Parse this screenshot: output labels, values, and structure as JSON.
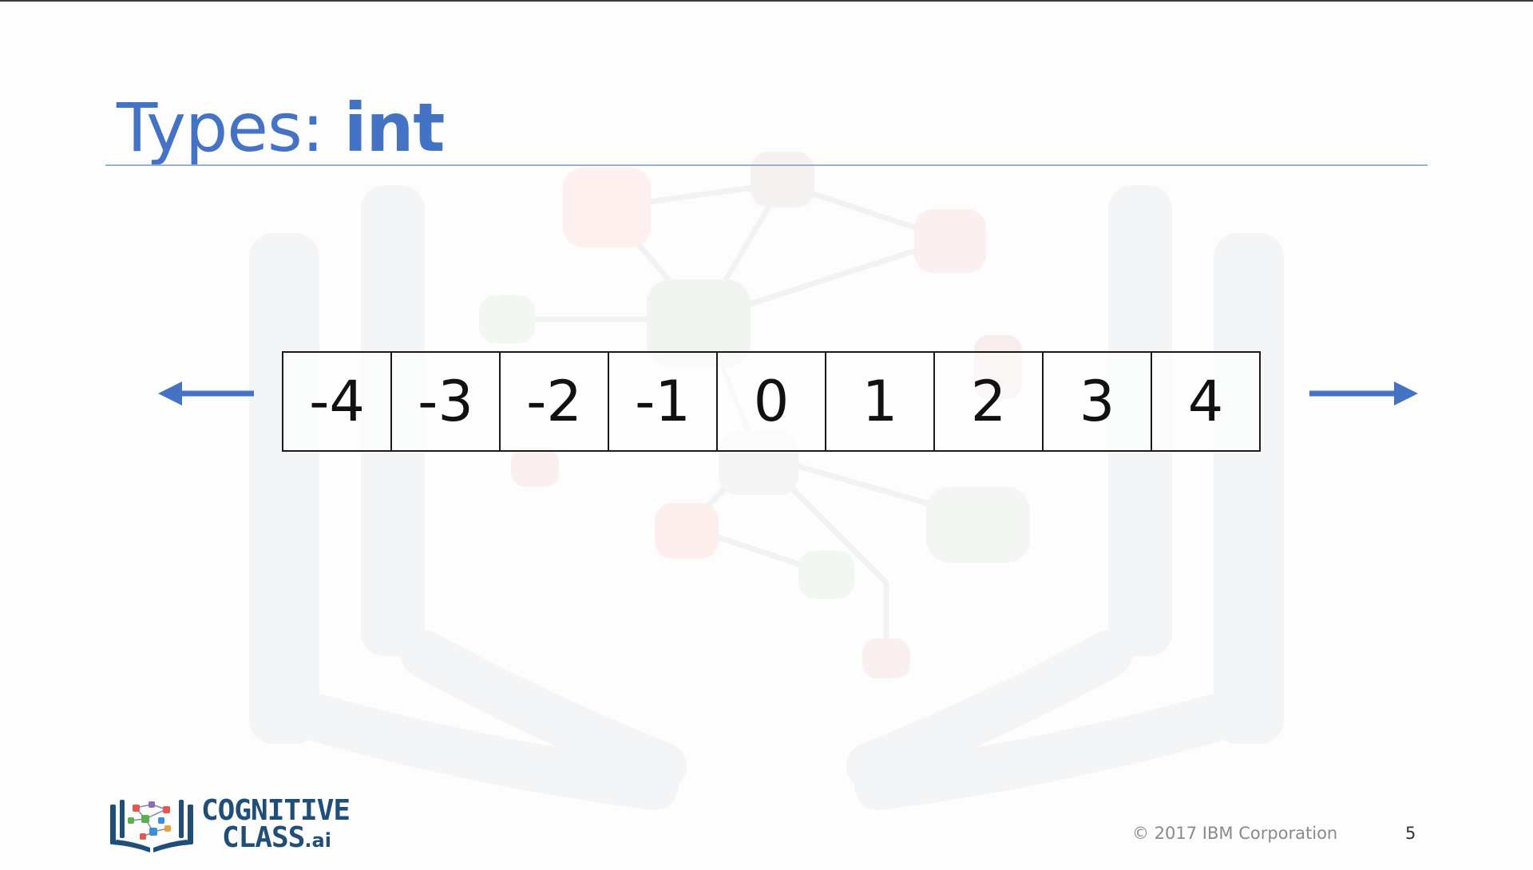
{
  "slide": {
    "title_prefix": "Types: ",
    "title_bold": "int",
    "number_line": {
      "values": [
        "-4",
        "-3",
        "-2",
        "-1",
        "0",
        "1",
        "2",
        "3",
        "4"
      ],
      "arrow_color": "#4472c4"
    },
    "logo": {
      "line1": "COGNITIVE",
      "line2": "CLASS",
      "suffix": ".ai",
      "color": "#1f4e79"
    },
    "footer": {
      "copyright": "© 2017 IBM Corporation",
      "page_number": "5"
    },
    "colors": {
      "title": "#4472c4",
      "rule": "#9aaed6"
    }
  }
}
